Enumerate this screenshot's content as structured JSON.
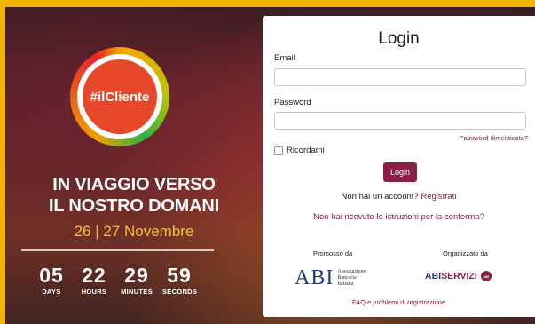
{
  "event": {
    "logo_text": "#ilCliente",
    "headline_line1": "IN VIAGGIO VERSO",
    "headline_line2": "IL NOSTRO DOMANI",
    "dates": "26 | 27 Novembre"
  },
  "countdown": [
    {
      "value": "05",
      "label": "DAYS"
    },
    {
      "value": "22",
      "label": "HOURS"
    },
    {
      "value": "29",
      "label": "MINUTES"
    },
    {
      "value": "59",
      "label": "SECONDS"
    }
  ],
  "login": {
    "title": "Login",
    "email_label": "Email",
    "email_value": "",
    "password_label": "Password",
    "password_value": "",
    "forgot_link": "Password dimenticata?",
    "remember_label": "Ricordami",
    "submit_label": "Login",
    "no_account_text": "Non hai un account?",
    "register_link": "Registrati",
    "resend_link": "Non hai ricevuto le istruzioni per la conferma?"
  },
  "sponsors": {
    "promoted_label": "Promosso da",
    "organized_label": "Organizzato da",
    "abi_mark": "ABI",
    "abi_line1": "Associazione",
    "abi_line2": "Bancaria",
    "abi_line3": "Italiana",
    "abiservizi_part1": "ABI",
    "abiservizi_part2": "SERVIZI",
    "abiservizi_badge": "ABI"
  },
  "footer": {
    "faq_link": "FAQ e problemi di registrazione"
  },
  "colors": {
    "accent": "#8a1e46",
    "background_frame": "#f2b400",
    "date_yellow": "#f6c02a"
  }
}
